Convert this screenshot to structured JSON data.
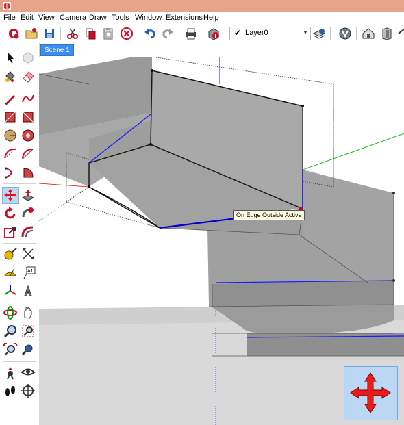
{
  "titlebar": {
    "app_icon": "sketchup-logo-icon"
  },
  "menu": [
    {
      "label": "File",
      "u": "F",
      "rest": "ile"
    },
    {
      "label": "Edit",
      "u": "E",
      "rest": "dit"
    },
    {
      "label": "View",
      "u": "V",
      "rest": "iew"
    },
    {
      "label": "Camera",
      "u": "C",
      "rest": "amera"
    },
    {
      "label": "Draw",
      "u": "D",
      "rest": "raw"
    },
    {
      "label": "Tools",
      "u": "T",
      "rest": "ools"
    },
    {
      "label": "Window",
      "u": "W",
      "rest": "indow"
    },
    {
      "label": "Extensions",
      "u": "E",
      "rest": "xtensions"
    },
    {
      "label": "Help",
      "u": "H",
      "rest": "elp"
    }
  ],
  "toolbar": {
    "layer": {
      "check": "✔",
      "name": "Layer0",
      "arrow": "▼"
    },
    "icons": [
      "new-icon",
      "open-icon",
      "save-icon",
      "cut-icon",
      "copy-icon",
      "paste-icon",
      "erase-icon",
      "undo-icon",
      "redo-icon",
      "print-icon",
      "model-info-icon",
      "layer-manager-icon",
      "styles-icon",
      "house-view-icon",
      "front-view-icon",
      "top-view-icon"
    ]
  },
  "scenes": {
    "tab_label": "Scene 1"
  },
  "left_tools": [
    [
      "select-icon",
      "component-icon"
    ],
    [
      "paint-bucket-icon",
      "eraser-icon"
    ],
    [
      "pencil-line-icon",
      "freehand-icon"
    ],
    [
      "rectangle-icon",
      "rotated-rectangle-icon"
    ],
    [
      "circle-icon",
      "polygon-icon"
    ],
    [
      "arc-icon",
      "two-point-arc-icon"
    ],
    [
      "three-point-arc-icon",
      "pie-icon"
    ],
    [
      "move-icon",
      "push-pull-icon"
    ],
    [
      "rotate-icon",
      "follow-me-icon"
    ],
    [
      "scale-icon",
      "offset-icon"
    ],
    [
      "tape-measure-icon",
      "dimension-icon"
    ],
    [
      "protractor-icon",
      "text-icon"
    ],
    [
      "axes-icon",
      "3d-text-icon"
    ],
    [
      "orbit-icon",
      "pan-icon"
    ],
    [
      "zoom-icon",
      "zoom-window-icon"
    ],
    [
      "zoom-extents-icon",
      "previous-view-icon"
    ],
    [
      "position-camera-icon",
      "look-around-icon"
    ],
    [
      "walk-icon",
      "section-plane-icon"
    ]
  ],
  "viewport": {
    "tooltip": "On Edge Outside Active",
    "colors": {
      "sky": "#ffffff",
      "ground": "#d9d9d9",
      "face": "#a9a9a9",
      "face_dark": "#8c8c8c",
      "edge": "#222222",
      "selected_edge": "#1a1aff",
      "axis_red": "#e00000",
      "axis_green": "#00a000",
      "axis_blue": "#0000e0"
    }
  },
  "move_overlay": {
    "icon": "move-arrows-icon"
  }
}
